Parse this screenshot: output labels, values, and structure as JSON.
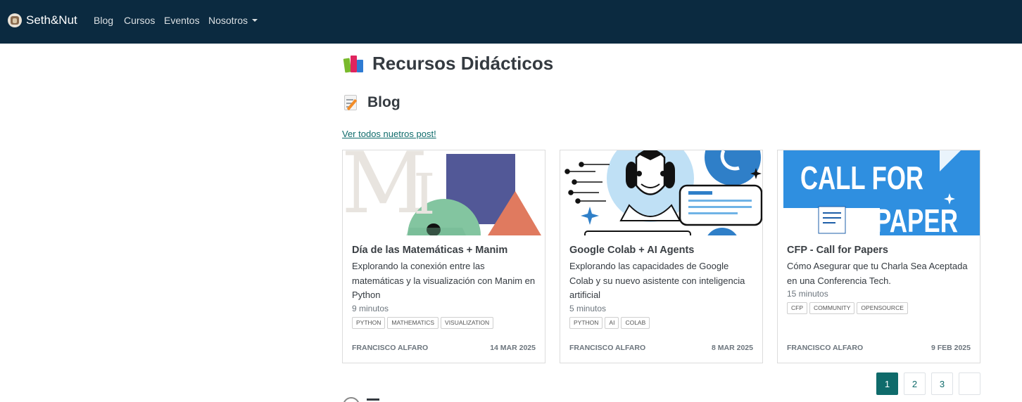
{
  "navbar": {
    "brand": "Seth&Nut",
    "links": [
      "Blog",
      "Cursos",
      "Eventos",
      "Nosotros"
    ]
  },
  "page": {
    "title": "Recursos Didácticos",
    "blog_heading": "Blog",
    "see_all_link": "Ver todos nuetros post!"
  },
  "cards": [
    {
      "title": "Día de las Matemáticas + Manim",
      "description": "Explorando la conexión entre las matemáticas y la visualización con Manim en Python",
      "read_time": "9 minutos",
      "tags": [
        "PYTHON",
        "MATHEMATICS",
        "VISUALIZATION"
      ],
      "author": "FRANCISCO ALFARO",
      "date": "14 MAR 2025"
    },
    {
      "title": "Google Colab + AI Agents",
      "description": "Explorando las capacidades de Google Colab y su nuevo asistente con inteligencia artificial",
      "read_time": "5 minutos",
      "tags": [
        "PYTHON",
        "AI",
        "COLAB"
      ],
      "author": "FRANCISCO ALFARO",
      "date": "8 MAR 2025"
    },
    {
      "title": "CFP - Call for Papers",
      "description": "Cómo Asegurar que tu Charla Sea Aceptada en una Conferencia Tech.",
      "read_time": "15 minutos",
      "tags": [
        "CFP",
        "COMMUNITY",
        "OPENSOURCE"
      ],
      "author": "FRANCISCO ALFARO",
      "date": "9 FEB 2025",
      "image_text": [
        "CALL FOR",
        "PAPER"
      ]
    }
  ],
  "pagination": {
    "pages": [
      "1",
      "2",
      "3"
    ],
    "current": "1"
  },
  "colors": {
    "navbar": "#0b2a40",
    "accent": "#0f6b6b"
  },
  "icons": {
    "brand": "logo-icon",
    "title": "books-icon",
    "blog": "memo-icon"
  }
}
